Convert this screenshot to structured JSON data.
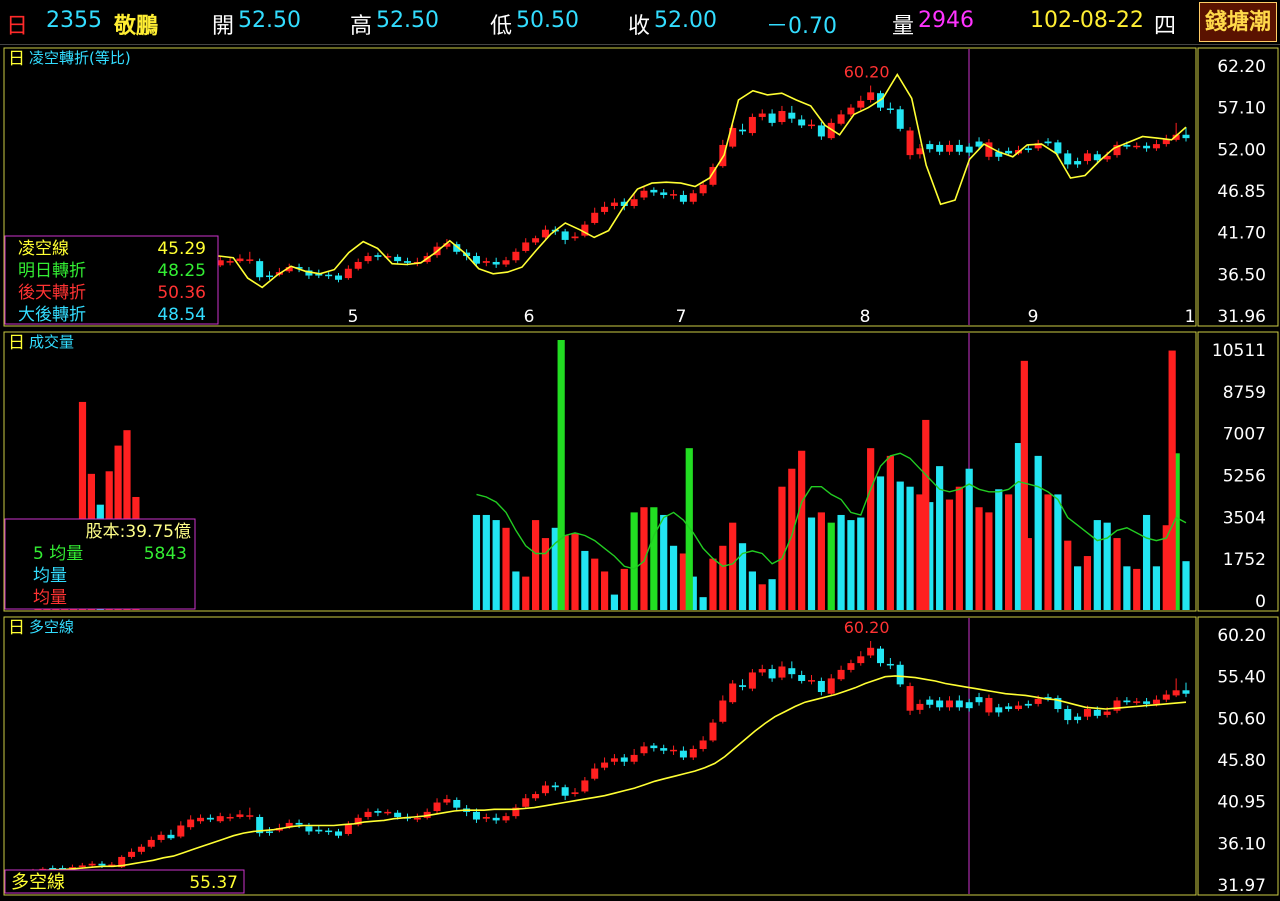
{
  "header": {
    "period": "日",
    "code": "2355",
    "name": "敬鵬",
    "open_label": "開",
    "open": "52.50",
    "high_label": "高",
    "high": "52.50",
    "low_label": "低",
    "low": "50.50",
    "close_label": "收",
    "close": "52.00",
    "change": "－0.70",
    "volume_label": "量",
    "volume": "2946",
    "date": "102-08-22",
    "weekday": "四",
    "logo": "錢塘潮"
  },
  "colors": {
    "up": "#ff2020",
    "down": "#22e5f2",
    "flat_vol": "#22dd22",
    "yellow_line": "#ffff33",
    "green_line": "#22cc22",
    "cursor": "#cc33cc",
    "frame": "#cccc44",
    "label_cyan": "#33ddff"
  },
  "chart_data": [
    {
      "type": "candlestick",
      "panel": "top",
      "title": "日 凌空轉折(等比)",
      "yticks": [
        "62.20",
        "57.10",
        "52.00",
        "46.85",
        "41.70",
        "36.50",
        "31.96"
      ],
      "ylim": [
        31.96,
        62.2
      ],
      "xticks": [
        "5",
        "6",
        "7",
        "8",
        "9",
        "1"
      ],
      "peak_label": "60.20",
      "legend": [
        {
          "label": "凌空線",
          "value": "45.29",
          "color": "#ffff33"
        },
        {
          "label": "明日轉折",
          "value": "48.25",
          "color": "#33ee33"
        },
        {
          "label": "後天轉折",
          "value": "50.36",
          "color": "#ff3333"
        },
        {
          "label": "大後轉折",
          "value": "48.54",
          "color": "#33ddff"
        }
      ],
      "line_name": "凌空線",
      "line_values": [
        39.8,
        39.9,
        39.6,
        39.7,
        40.1,
        39.9,
        37.5,
        36.4,
        37.8,
        38.9,
        38.3,
        38.0,
        38.5,
        40.5,
        41.8,
        41.0,
        39.2,
        39.1,
        39.3,
        40.5,
        41.9,
        40.5,
        38.6,
        38.0,
        38.2,
        38.8,
        40.8,
        42.7,
        44.0,
        43.2,
        42.3,
        43.1,
        45.8,
        48.0,
        48.7,
        48.8,
        48.7,
        48.3,
        49.3,
        52.0,
        58.5,
        59.6,
        59.1,
        59.3,
        58.5,
        57.8,
        55.5,
        54.4,
        56.8,
        57.6,
        58.7,
        61.5,
        58.7,
        50.8,
        46.2,
        46.7,
        51.5,
        53.3,
        52.4,
        51.8,
        53.2,
        53.3,
        52.2,
        49.3,
        49.6,
        51.3,
        52.8,
        53.5,
        54.2,
        54.0,
        53.8,
        55.3
      ]
    },
    {
      "type": "bar",
      "panel": "middle",
      "title": "日 成交量",
      "yticks": [
        "10511",
        "8759",
        "7007",
        "5256",
        "3504",
        "1752",
        "0"
      ],
      "ylim": [
        0,
        10511
      ],
      "legend": [
        {
          "label": "股本:39.75億",
          "color": "#ffff88"
        },
        {
          "label": "5 均量",
          "value": "5843",
          "color": "#33ee33"
        },
        {
          "label": "均量",
          "color": "#33ddff"
        },
        {
          "label": "均量",
          "color": "#ff3333"
        }
      ],
      "values": [
        3700,
        3700,
        3500,
        3200,
        1500,
        1300,
        3500,
        2800,
        3200,
        2900,
        3000,
        2300,
        2000,
        1500,
        600,
        1600,
        3800,
        4000,
        4000,
        3700,
        2500,
        2200,
        1300,
        500,
        2000,
        2500,
        3400,
        2600,
        1500,
        1000,
        1200,
        4800,
        5500,
        6200,
        3600,
        3800,
        3400,
        3700,
        3500,
        3600,
        6300,
        5200,
        6000,
        5000,
        4800,
        4500,
        4200,
        5600,
        4300,
        4800,
        5500,
        4000,
        3800,
        4700,
        4500,
        6500,
        2800,
        6000,
        4500,
        4500,
        2700,
        1700,
        2100,
        3500,
        3400,
        2800,
        1700,
        1600,
        3700,
        1700,
        3300,
        6100,
        1900
      ],
      "colors": [
        "c",
        "c",
        "c",
        "r",
        "c",
        "r",
        "r",
        "r",
        "c",
        "r",
        "r",
        "c",
        "r",
        "r",
        "c",
        "r",
        "g",
        "r",
        "g",
        "c",
        "c",
        "r",
        "c",
        "c",
        "r",
        "r",
        "r",
        "c",
        "c",
        "r",
        "c",
        "r",
        "r",
        "r",
        "c",
        "r",
        "g",
        "c",
        "c",
        "c",
        "r",
        "c",
        "r",
        "c",
        "c",
        "r",
        "c",
        "c",
        "r",
        "r",
        "c",
        "r",
        "r",
        "c",
        "r",
        "c",
        "r",
        "c",
        "r",
        "c",
        "r",
        "c",
        "r",
        "c",
        "c",
        "r",
        "c",
        "r",
        "c",
        "c",
        "r",
        "g",
        "c"
      ],
      "ma_values": [
        4500,
        4400,
        4200,
        3800,
        3100,
        2500,
        2200,
        2200,
        2600,
        2900,
        3000,
        2900,
        2700,
        2400,
        2100,
        1700,
        1600,
        1900,
        2900,
        3600,
        3800,
        3500,
        3000,
        2400,
        2000,
        1700,
        1800,
        2200,
        2300,
        2200,
        1800,
        2000,
        2900,
        4200,
        4800,
        4800,
        4500,
        4300,
        3800,
        3700,
        4700,
        5600,
        6000,
        6100,
        5900,
        5500,
        5100,
        4700,
        4600,
        4700,
        4900,
        4700,
        4600,
        4600,
        4700,
        5000,
        4900,
        4800,
        4600,
        4300,
        3600,
        3300,
        3000,
        2700,
        2800,
        3100,
        3200,
        3000,
        2800,
        2700,
        2800,
        3600,
        3400
      ],
      "pre_values": [
        1800,
        800,
        1600,
        3100,
        1500,
        8100,
        5300,
        4100,
        5400,
        6400,
        7000,
        4400
      ],
      "pre_colors": [
        "r",
        "r",
        "r",
        "r",
        "r",
        "r",
        "r",
        "c",
        "r",
        "r",
        "r",
        "r"
      ]
    },
    {
      "type": "candlestick",
      "panel": "bottom",
      "title": "日 多空線",
      "yticks": [
        "60.20",
        "55.40",
        "50.60",
        "45.80",
        "40.95",
        "36.10",
        "31.97"
      ],
      "ylim": [
        31.97,
        60.2
      ],
      "peak_label": "60.20",
      "legend": [
        {
          "label": "多空線",
          "value": "55.37",
          "color": "#ffff33"
        }
      ],
      "line_name": "多空線"
    }
  ],
  "candles": [
    [
      33.0,
      33.2,
      33.4,
      32.8,
      "r"
    ],
    [
      33.2,
      33.4,
      33.6,
      33.0,
      "r"
    ],
    [
      33.4,
      33.5,
      33.8,
      33.2,
      "c"
    ],
    [
      33.5,
      33.4,
      33.8,
      33.1,
      "c"
    ],
    [
      33.4,
      33.6,
      33.9,
      33.2,
      "r"
    ],
    [
      33.6,
      33.8,
      34.1,
      33.4,
      "r"
    ],
    [
      33.8,
      34.0,
      34.3,
      33.6,
      "r"
    ],
    [
      34.0,
      33.8,
      34.3,
      33.5,
      "c"
    ],
    [
      33.8,
      33.9,
      34.2,
      33.6,
      "r"
    ],
    [
      33.6,
      34.8,
      35.0,
      33.5,
      "r"
    ],
    [
      34.8,
      35.4,
      35.8,
      34.6,
      "r"
    ],
    [
      35.4,
      36.0,
      36.3,
      35.1,
      "r"
    ],
    [
      36.0,
      36.8,
      37.2,
      35.8,
      "r"
    ],
    [
      36.8,
      37.4,
      37.8,
      36.5,
      "r"
    ],
    [
      37.4,
      37.0,
      38.0,
      36.8,
      "c"
    ],
    [
      37.2,
      38.5,
      39.0,
      37.0,
      "r"
    ],
    [
      38.3,
      39.2,
      39.7,
      38.0,
      "r"
    ],
    [
      39.0,
      39.4,
      39.8,
      38.7,
      "r"
    ],
    [
      39.4,
      39.2,
      39.8,
      38.9,
      "c"
    ],
    [
      39.0,
      39.6,
      40.0,
      38.8,
      "r"
    ],
    [
      39.4,
      39.5,
      39.9,
      39.0,
      "r"
    ],
    [
      39.5,
      39.8,
      40.3,
      39.3,
      "r"
    ],
    [
      39.6,
      39.7,
      40.6,
      39.2,
      "r"
    ],
    [
      39.5,
      37.6,
      39.8,
      37.2,
      "c"
    ],
    [
      37.8,
      37.8,
      38.3,
      37.3,
      "c"
    ],
    [
      37.9,
      38.2,
      38.7,
      37.7,
      "r"
    ],
    [
      38.3,
      38.8,
      39.2,
      38.1,
      "r"
    ],
    [
      38.8,
      38.6,
      39.2,
      38.2,
      "c"
    ],
    [
      38.4,
      37.8,
      38.8,
      37.4,
      "c"
    ],
    [
      37.8,
      38.0,
      38.5,
      37.5,
      "c"
    ],
    [
      37.9,
      37.8,
      38.2,
      37.4,
      "c"
    ],
    [
      37.8,
      37.3,
      38.1,
      37.0,
      "c"
    ],
    [
      37.5,
      38.6,
      39.0,
      37.3,
      "r"
    ],
    [
      38.6,
      39.4,
      39.8,
      38.4,
      "r"
    ],
    [
      39.5,
      40.1,
      40.5,
      39.2,
      "r"
    ],
    [
      40.2,
      40.0,
      40.5,
      39.6,
      "c"
    ],
    [
      40.1,
      40.1,
      40.4,
      39.7,
      "r"
    ],
    [
      40.0,
      39.5,
      40.3,
      39.2,
      "c"
    ],
    [
      39.5,
      39.3,
      39.9,
      39.0,
      "c"
    ],
    [
      39.2,
      39.4,
      39.9,
      38.9,
      "r"
    ],
    [
      39.4,
      40.1,
      40.5,
      39.2,
      "r"
    ],
    [
      40.2,
      41.2,
      41.7,
      39.9,
      "r"
    ],
    [
      41.2,
      41.6,
      42.1,
      40.9,
      "r"
    ],
    [
      41.5,
      40.6,
      41.8,
      40.3,
      "c"
    ],
    [
      40.5,
      40.1,
      40.9,
      39.6,
      "c"
    ],
    [
      40.1,
      39.2,
      40.5,
      38.8,
      "c"
    ],
    [
      39.3,
      39.5,
      39.9,
      38.9,
      "r"
    ],
    [
      39.4,
      39.1,
      39.9,
      38.7,
      "c"
    ],
    [
      39.1,
      39.6,
      40.0,
      38.8,
      "r"
    ],
    [
      39.6,
      40.6,
      41.0,
      39.3,
      "r"
    ],
    [
      40.7,
      41.7,
      42.2,
      40.5,
      "r"
    ],
    [
      41.7,
      42.2,
      42.5,
      41.4,
      "r"
    ],
    [
      42.3,
      43.2,
      43.7,
      42.0,
      "r"
    ],
    [
      43.2,
      43.0,
      43.6,
      42.6,
      "c"
    ],
    [
      43.0,
      42.0,
      43.3,
      41.5,
      "c"
    ],
    [
      42.2,
      42.4,
      42.9,
      41.9,
      "r"
    ],
    [
      42.5,
      43.8,
      44.2,
      42.3,
      "r"
    ],
    [
      44.0,
      45.2,
      45.8,
      43.8,
      "r"
    ],
    [
      45.3,
      45.9,
      46.5,
      45.0,
      "r"
    ],
    [
      46.0,
      46.4,
      46.9,
      45.6,
      "r"
    ],
    [
      46.5,
      46.0,
      46.9,
      45.5,
      "c"
    ],
    [
      46.0,
      46.8,
      47.5,
      45.7,
      "r"
    ],
    [
      47.0,
      47.8,
      48.3,
      46.7,
      "r"
    ],
    [
      47.9,
      47.6,
      48.2,
      47.2,
      "c"
    ],
    [
      47.6,
      47.3,
      48.0,
      46.9,
      "c"
    ],
    [
      47.3,
      47.4,
      47.9,
      46.8,
      "r"
    ],
    [
      47.3,
      46.5,
      47.8,
      46.2,
      "c"
    ],
    [
      46.5,
      47.5,
      47.9,
      46.2,
      "r"
    ],
    [
      47.5,
      48.5,
      49.0,
      47.2,
      "r"
    ],
    [
      48.5,
      50.6,
      51.0,
      48.3,
      "r"
    ],
    [
      50.7,
      53.2,
      53.8,
      50.5,
      "r"
    ],
    [
      53.0,
      55.2,
      55.6,
      52.8,
      "r"
    ],
    [
      55.0,
      54.8,
      55.7,
      54.4,
      "c"
    ],
    [
      54.6,
      56.5,
      56.9,
      54.3,
      "r"
    ],
    [
      56.5,
      56.9,
      57.4,
      56.1,
      "r"
    ],
    [
      56.9,
      55.8,
      57.4,
      55.4,
      "c"
    ],
    [
      55.9,
      57.2,
      57.8,
      55.6,
      "r"
    ],
    [
      57.0,
      56.3,
      57.8,
      55.8,
      "c"
    ],
    [
      56.2,
      55.5,
      56.7,
      55.2,
      "c"
    ],
    [
      55.5,
      55.6,
      56.2,
      55.1,
      "r"
    ],
    [
      55.5,
      54.2,
      55.9,
      53.8,
      "c"
    ],
    [
      54.0,
      55.8,
      56.3,
      53.8,
      "r"
    ],
    [
      55.7,
      56.8,
      57.3,
      55.5,
      "r"
    ],
    [
      56.8,
      57.6,
      58.0,
      56.5,
      "r"
    ],
    [
      57.6,
      58.4,
      59.0,
      57.3,
      "r"
    ],
    [
      58.5,
      59.4,
      60.2,
      58.2,
      "r"
    ],
    [
      59.3,
      57.6,
      59.6,
      57.2,
      "c"
    ],
    [
      57.5,
      57.4,
      58.2,
      56.9,
      "c"
    ],
    [
      57.4,
      55.1,
      57.8,
      54.8,
      "c"
    ],
    [
      54.9,
      52.0,
      55.3,
      51.5,
      "r"
    ],
    [
      52.1,
      52.8,
      53.3,
      51.6,
      "r"
    ],
    [
      52.7,
      53.3,
      53.7,
      52.3,
      "c"
    ],
    [
      53.2,
      52.4,
      53.6,
      52.0,
      "c"
    ],
    [
      52.4,
      53.2,
      53.7,
      52.0,
      "r"
    ],
    [
      53.2,
      52.4,
      53.8,
      52.0,
      "c"
    ],
    [
      52.3,
      53.0,
      53.4,
      51.9,
      "c"
    ],
    [
      53.0,
      53.6,
      54.1,
      52.6,
      "c"
    ],
    [
      53.5,
      51.8,
      53.9,
      51.4,
      "r"
    ],
    [
      51.8,
      52.4,
      52.8,
      51.3,
      "c"
    ],
    [
      52.5,
      52.2,
      52.9,
      51.9,
      "c"
    ],
    [
      52.2,
      52.6,
      53.1,
      52.0,
      "r"
    ],
    [
      52.6,
      52.8,
      53.2,
      52.3,
      "c"
    ],
    [
      52.8,
      53.4,
      53.8,
      52.5,
      "r"
    ],
    [
      53.4,
      53.6,
      54.0,
      53.1,
      "c"
    ],
    [
      53.5,
      52.2,
      53.8,
      51.8,
      "c"
    ],
    [
      52.2,
      50.9,
      52.6,
      50.4,
      "c"
    ],
    [
      50.9,
      51.3,
      51.7,
      50.5,
      "c"
    ],
    [
      51.3,
      52.2,
      52.6,
      50.9,
      "r"
    ],
    [
      52.1,
      51.4,
      52.5,
      51.1,
      "c"
    ],
    [
      51.5,
      51.9,
      52.4,
      51.2,
      "r"
    ],
    [
      52.0,
      53.2,
      53.6,
      51.7,
      "r"
    ],
    [
      53.2,
      53.0,
      53.6,
      52.7,
      "c"
    ],
    [
      53.0,
      53.1,
      53.5,
      52.7,
      "r"
    ],
    [
      53.1,
      52.8,
      53.5,
      52.4,
      "c"
    ],
    [
      52.8,
      53.3,
      53.8,
      52.5,
      "r"
    ],
    [
      53.3,
      53.9,
      54.4,
      53.0,
      "r"
    ],
    [
      53.8,
      54.4,
      55.8,
      53.6,
      "r"
    ],
    [
      54.4,
      54.0,
      55.3,
      53.6,
      "c"
    ]
  ],
  "bottom_line": [
    33.2,
    33.2,
    33.3,
    33.3,
    33.4,
    33.5,
    33.6,
    33.7,
    33.7,
    33.8,
    34.0,
    34.2,
    34.4,
    34.7,
    34.9,
    35.3,
    35.7,
    36.1,
    36.5,
    36.9,
    37.3,
    37.6,
    37.8,
    37.9,
    38.0,
    38.2,
    38.4,
    38.5,
    38.5,
    38.5,
    38.5,
    38.6,
    38.7,
    38.9,
    39.0,
    39.1,
    39.3,
    39.4,
    39.5,
    39.6,
    39.8,
    40.0,
    40.2,
    40.3,
    40.3,
    40.3,
    40.4,
    40.4,
    40.4,
    40.5,
    40.6,
    40.8,
    41.0,
    41.2,
    41.4,
    41.6,
    41.8,
    42.0,
    42.3,
    42.6,
    42.9,
    43.3,
    43.7,
    44.0,
    44.3,
    44.6,
    44.9,
    45.3,
    45.8,
    46.6,
    47.6,
    48.6,
    49.6,
    50.5,
    51.3,
    51.9,
    52.5,
    53.0,
    53.3,
    53.6,
    53.9,
    54.3,
    54.7,
    55.2,
    55.6,
    56.0,
    56.1,
    56.0,
    55.9,
    55.7,
    55.5,
    55.2,
    55.0,
    54.8,
    54.6,
    54.4,
    54.2,
    54.0,
    53.9,
    53.8,
    53.6,
    53.4,
    53.3,
    53.0,
    52.7,
    52.4,
    52.3,
    52.2,
    52.3,
    52.4,
    52.5,
    52.6,
    52.7,
    52.8,
    52.9,
    53.0
  ]
}
